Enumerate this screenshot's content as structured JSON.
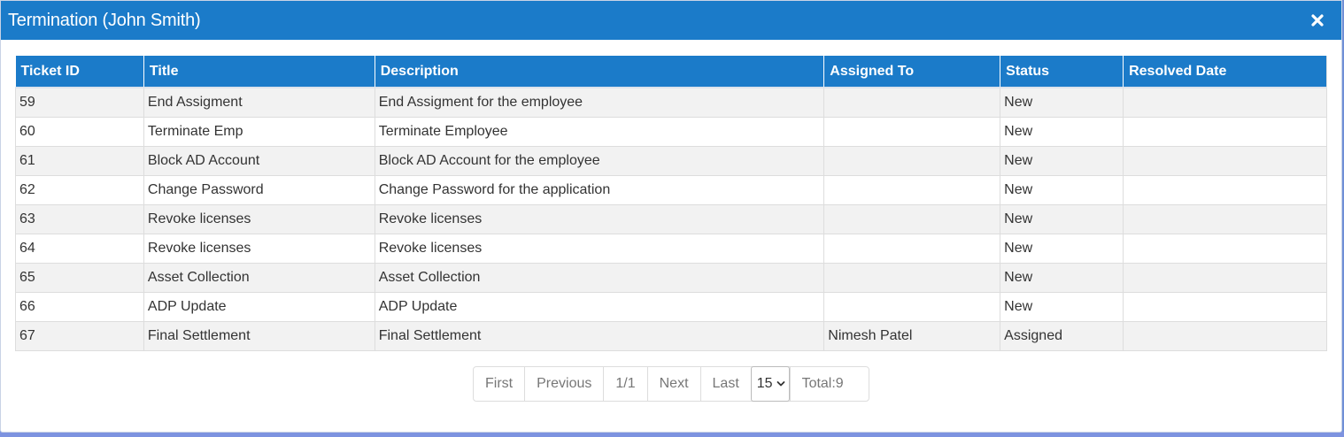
{
  "modal": {
    "title": "Termination (John Smith)"
  },
  "table": {
    "columns": [
      "Ticket ID",
      "Title",
      "Description",
      "Assigned To",
      "Status",
      "Resolved Date"
    ],
    "rows": [
      [
        "59",
        "End Assigment",
        "End Assigment for the employee",
        "",
        "New",
        ""
      ],
      [
        "60",
        "Terminate Emp",
        "Terminate Employee",
        "",
        "New",
        ""
      ],
      [
        "61",
        "Block AD Account",
        "Block AD Account for the employee",
        "",
        "New",
        ""
      ],
      [
        "62",
        "Change Password",
        "Change Password for the application",
        "",
        "New",
        ""
      ],
      [
        "63",
        "Revoke licenses",
        "Revoke licenses",
        "",
        "New",
        ""
      ],
      [
        "64",
        "Revoke licenses",
        "Revoke licenses",
        "",
        "New",
        ""
      ],
      [
        "65",
        "Asset Collection",
        "Asset Collection",
        "",
        "New",
        ""
      ],
      [
        "66",
        "ADP Update",
        "ADP Update",
        "",
        "New",
        ""
      ],
      [
        "67",
        "Final Settlement",
        "Final Settlement",
        "Nimesh Patel",
        "Assigned",
        ""
      ]
    ]
  },
  "pager": {
    "first": "First",
    "previous": "Previous",
    "page_info": "1/1",
    "next": "Next",
    "last": "Last",
    "page_size": "15",
    "total": "Total:9"
  },
  "colors": {
    "header_blue": "#1b7bc9",
    "row_alt": "#f2f2f2"
  }
}
